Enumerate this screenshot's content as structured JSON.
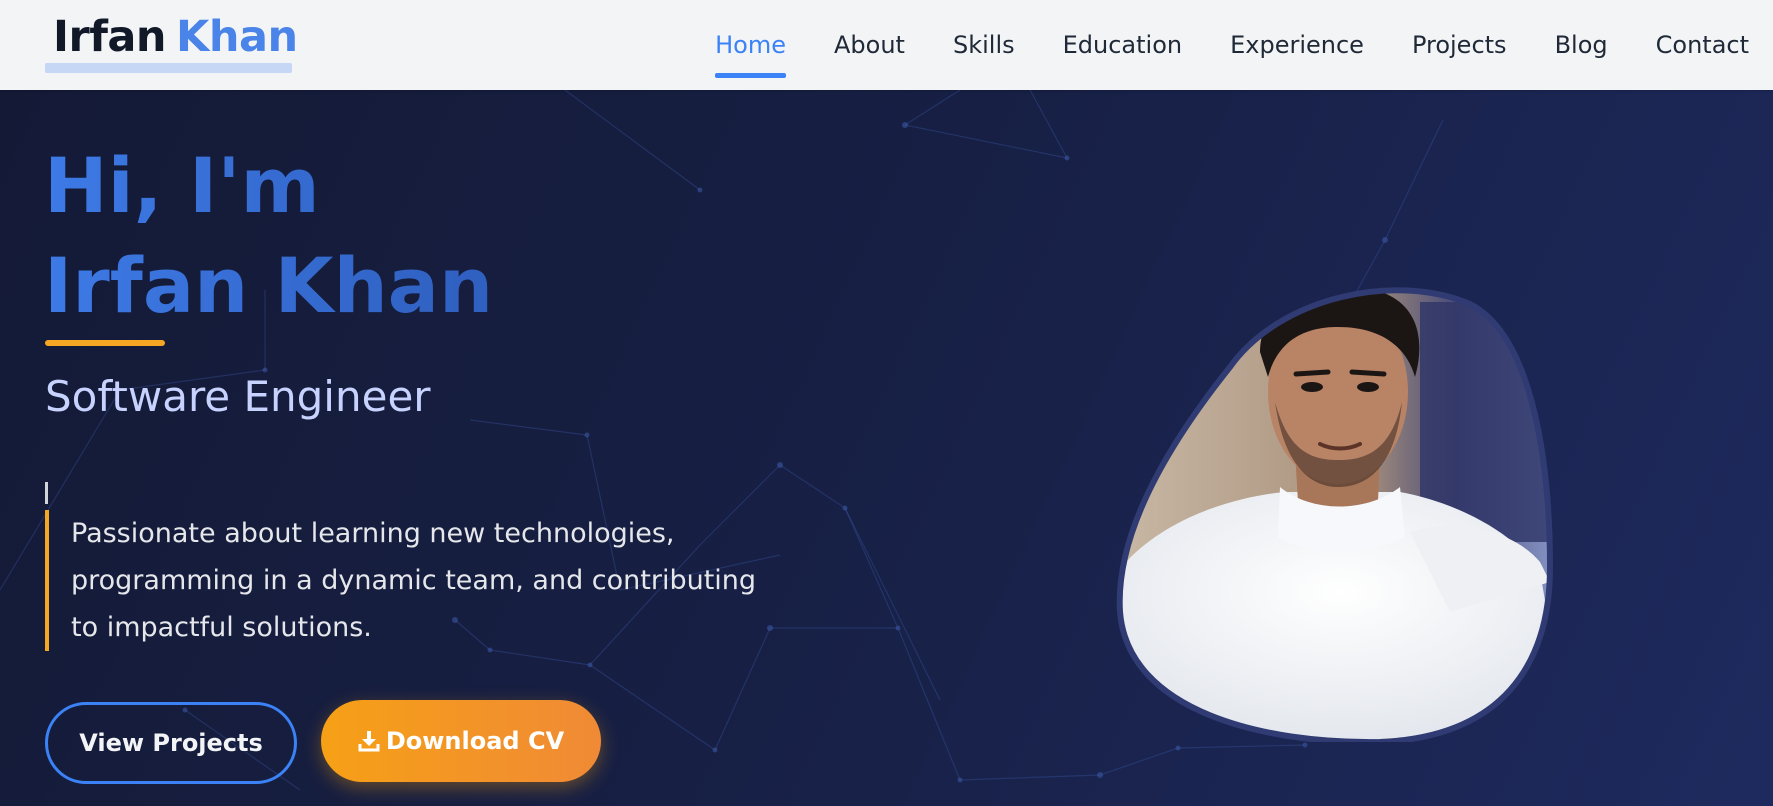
{
  "nav": {
    "logo_first": "Irfan",
    "logo_last": "Khan",
    "links": [
      {
        "label": "Home",
        "active": true
      },
      {
        "label": "About",
        "active": false
      },
      {
        "label": "Skills",
        "active": false
      },
      {
        "label": "Education",
        "active": false
      },
      {
        "label": "Experience",
        "active": false
      },
      {
        "label": "Projects",
        "active": false
      },
      {
        "label": "Blog",
        "active": false
      },
      {
        "label": "Contact",
        "active": false
      }
    ]
  },
  "hero": {
    "greeting_line1": "Hi, I'm",
    "greeting_line2": "Irfan Khan",
    "role": "Software Engineer",
    "tagline": "Passionate about learning new technologies, programming in a dynamic team, and contributing to impactful solutions.",
    "primary_button": "View Projects",
    "secondary_button": "Download CV",
    "secondary_button_icon": "download-icon"
  },
  "colors": {
    "accent_blue": "#3b82f6",
    "accent_orange": "#f5a623",
    "navbar_bg": "#f3f4f6",
    "hero_bg": "#172045"
  }
}
